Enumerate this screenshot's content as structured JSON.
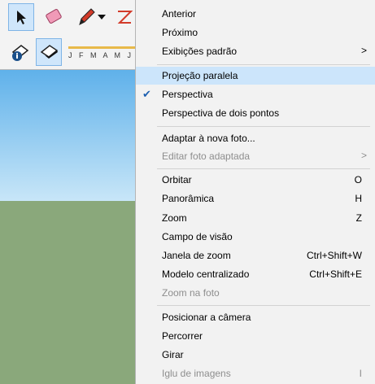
{
  "toolbar": {
    "months_label": "J F M A M J J"
  },
  "menu": {
    "items": [
      {
        "label": "Anterior",
        "shortcut": "",
        "state": "normal"
      },
      {
        "label": "Próximo",
        "shortcut": "",
        "state": "normal"
      },
      {
        "label": "Exibições padrão",
        "shortcut": "",
        "state": "normal",
        "submenu": ">"
      },
      {
        "label": "Projeção paralela",
        "shortcut": "",
        "state": "highlighted"
      },
      {
        "label": "Perspectiva",
        "shortcut": "",
        "state": "checked",
        "check": "✔"
      },
      {
        "label": "Perspectiva de dois pontos",
        "shortcut": "",
        "state": "normal"
      },
      {
        "label": "Adaptar à nova foto...",
        "shortcut": "",
        "state": "normal"
      },
      {
        "label": "Editar foto adaptada",
        "shortcut": "",
        "state": "disabled",
        "submenu": ">"
      },
      {
        "label": "Orbitar",
        "shortcut": "O",
        "state": "normal"
      },
      {
        "label": "Panorâmica",
        "shortcut": "H",
        "state": "normal"
      },
      {
        "label": "Zoom",
        "shortcut": "Z",
        "state": "normal"
      },
      {
        "label": "Campo de visão",
        "shortcut": "",
        "state": "normal"
      },
      {
        "label": "Janela de zoom",
        "shortcut": "Ctrl+Shift+W",
        "state": "normal"
      },
      {
        "label": "Modelo centralizado",
        "shortcut": "Ctrl+Shift+E",
        "state": "normal"
      },
      {
        "label": "Zoom na foto",
        "shortcut": "",
        "state": "disabled"
      },
      {
        "label": "Posicionar a câmera",
        "shortcut": "",
        "state": "normal"
      },
      {
        "label": "Percorrer",
        "shortcut": "",
        "state": "normal"
      },
      {
        "label": "Girar",
        "shortcut": "",
        "state": "normal"
      },
      {
        "label": "Iglu de imagens",
        "shortcut": "I",
        "state": "disabled"
      }
    ]
  },
  "colors": {
    "highlight": "#cce5fb",
    "disabled_text": "#8e8e8e",
    "sky": "#5fb1ea",
    "ground": "#8aa87b"
  },
  "icons": [
    "select-arrow-icon",
    "eraser-icon",
    "pencil-icon",
    "dropdown-arrow-icon",
    "shape-icon",
    "info-icon",
    "paint-bucket-icon",
    "shadow-icon"
  ]
}
